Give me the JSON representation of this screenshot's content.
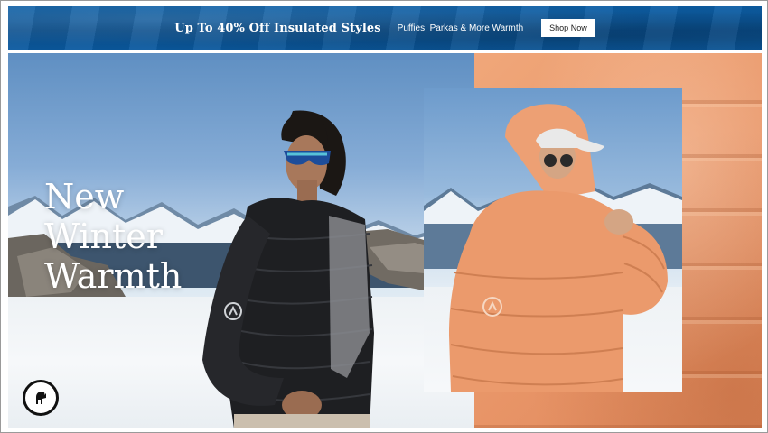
{
  "promo": {
    "title": "Up To 40% Off Insulated Styles",
    "subtitle": "Puffies, Parkas & More Warmth",
    "button_label": "Shop Now"
  },
  "hero": {
    "headline_lines": [
      "New",
      "Winter",
      "Warmth"
    ]
  },
  "brand": {
    "logo_icon": "goat-logo-icon"
  },
  "colors": {
    "promo_bg": "#0b5aa0",
    "jacket_orange": "#eb9a6c",
    "jacket_black": "#1e1f22"
  }
}
